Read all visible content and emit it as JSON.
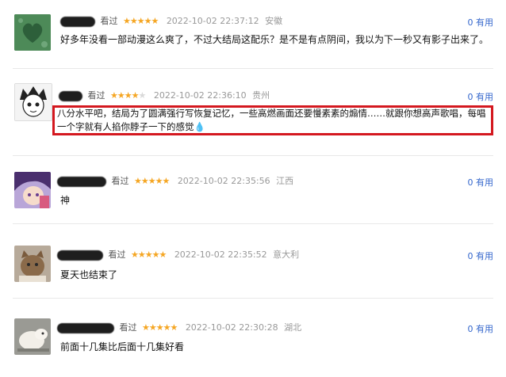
{
  "reviews": [
    {
      "rated_label": "看过",
      "stars": 5,
      "time": "2022-10-02 22:37:12",
      "location": "安徽",
      "useful_count": "0",
      "useful_label": "有用",
      "content": "好多年没看一部动漫这么爽了，不过大结局这配乐？是不是有点阴间，我以为下一秒又有影子出来了。"
    },
    {
      "rated_label": "看过",
      "stars": 4,
      "time": "2022-10-02 22:36:10",
      "location": "贵州",
      "useful_count": "0",
      "useful_label": "有用",
      "content_line1": "八分水平吧，结局为了圆满强行写恢复记忆，一些高燃画面还要慢素素的煽情……就跟你想高声歌唱，每唱",
      "content_line2": "一个字就有人掐你脖子一下的感觉",
      "content_emoji": "💧"
    },
    {
      "rated_label": "看过",
      "stars": 5,
      "time": "2022-10-02 22:35:56",
      "location": "江西",
      "useful_count": "0",
      "useful_label": "有用",
      "content": "神"
    },
    {
      "rated_label": "看过",
      "stars": 5,
      "time": "2022-10-02 22:35:52",
      "location": "意大利",
      "useful_count": "0",
      "useful_label": "有用",
      "content": "夏天也结束了"
    },
    {
      "rated_label": "看过",
      "stars": 5,
      "time": "2022-10-02 22:30:28",
      "location": "湖北",
      "useful_count": "0",
      "useful_label": "有用",
      "content": "前面十几集比后面十几集好看"
    }
  ],
  "colors": {
    "star": "#f5a623",
    "useful_link": "#3366cc",
    "highlight": "#d4181f"
  }
}
